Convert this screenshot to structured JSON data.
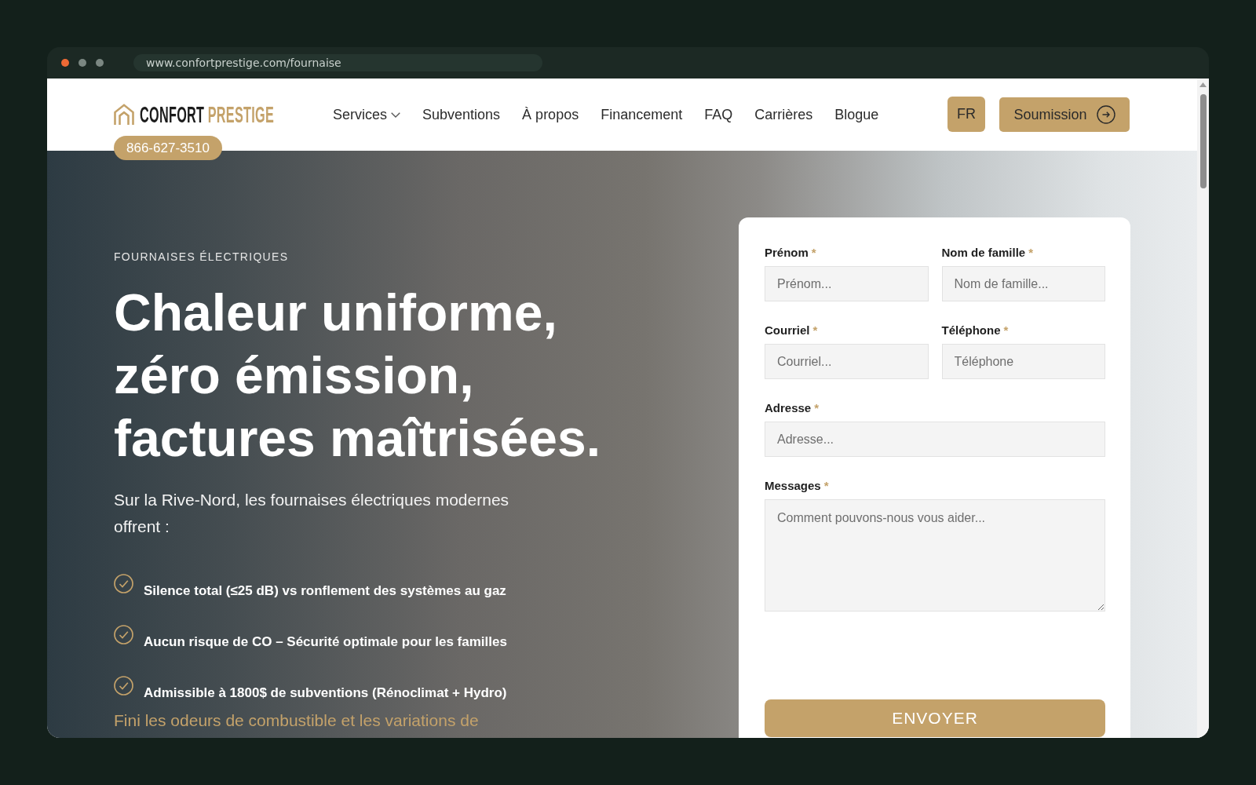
{
  "browser": {
    "window_controls": [
      {
        "color": "#ee6a35"
      },
      {
        "color": "#7b8782"
      },
      {
        "color": "#7b8782"
      }
    ],
    "url": "www.confortprestige.com/fournaise"
  },
  "header": {
    "logo": {
      "word_1": "CONFORT",
      "word_2": "PRESTIGE"
    },
    "nav": [
      {
        "label": "Services",
        "dropdown": true
      },
      {
        "label": "Subventions",
        "dropdown": false
      },
      {
        "label": "À propos",
        "dropdown": false
      },
      {
        "label": "Financement",
        "dropdown": false
      },
      {
        "label": "FAQ",
        "dropdown": false
      },
      {
        "label": "Carrières",
        "dropdown": false
      },
      {
        "label": "Blogue",
        "dropdown": false
      }
    ],
    "language": "FR",
    "cta": "Soumission",
    "phone": "866-627-3510"
  },
  "hero": {
    "eyebrow": "FOURNAISES ÉLECTRIQUES",
    "title": "Chaleur uniforme, zéro émission, factures maîtrisées.",
    "intro": "Sur la Rive-Nord, les fournaises électriques modernes offrent :",
    "benefits": [
      "Silence total (≤25 dB) vs ronflement des systèmes au gaz",
      "Aucun risque de CO – Sécurité optimale pour les familles",
      "Admissible à 1800$ de subventions (Rénoclimat + Hydro)"
    ],
    "closing": "Fini les odeurs de combustible et les variations de"
  },
  "form": {
    "fields": [
      {
        "kind": "short",
        "label": "Prénom",
        "required_mark": "*",
        "placeholder": "Prénom..."
      },
      {
        "kind": "short",
        "label": "Nom de famille",
        "required_mark": "*",
        "placeholder": "Nom de famille..."
      },
      {
        "kind": "short",
        "label": "Courriel",
        "required_mark": "*",
        "placeholder": "Courriel..."
      },
      {
        "kind": "short",
        "label": "Téléphone",
        "required_mark": "*",
        "placeholder": "Téléphone"
      },
      {
        "kind": "long",
        "label": "Adresse",
        "required_mark": "*",
        "placeholder": "Adresse..."
      },
      {
        "kind": "multiline",
        "label": "Messages",
        "required_mark": "*",
        "placeholder": "Comment pouvons-nous vous aider..."
      }
    ],
    "submit": "ENVOYER"
  }
}
